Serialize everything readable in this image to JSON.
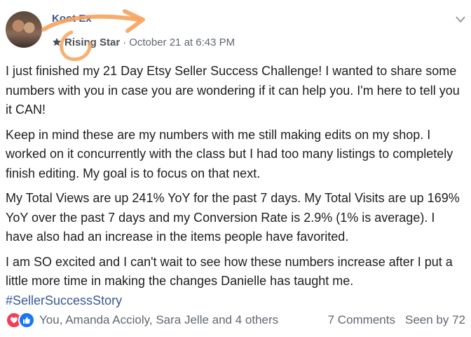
{
  "post": {
    "author": "Koot Ex",
    "badge": "Rising Star",
    "separator": "·",
    "timestamp": "October 21 at 6:43 PM",
    "paragraphs": [
      "I just finished my 21 Day Etsy Seller Success Challenge! I wanted to share some numbers with you in case you are wondering if it can help you. I'm here to tell you it CAN!",
      "Keep in mind these are my numbers with me still making edits on my shop. I worked on it concurrently with the class but I had too many listings to completely finish editing. My goal is to focus on that next.",
      "My Total Views are up 241% YoY for the past 7 days. My Total Visits are up 169% YoY over the past 7 days and my Conversion Rate is 2.9% (1% is average). I have also had an increase in the items people have favorited.",
      "I am SO excited and I can't wait to see how these numbers increase after I put a little more time in making the changes Danielle has taught me."
    ],
    "hashtag": "#SellerSuccessStory"
  },
  "footer": {
    "reactors": "You, Amanda Accioly, Sara Jelle and 4 others",
    "comments": "7 Comments",
    "seen_by": "Seen by 72"
  },
  "icons": {
    "badge": "star-icon",
    "menu": "chevron-down-icon",
    "love": "heart-icon",
    "like": "thumbs-up-icon"
  },
  "colors": {
    "link": "#385898",
    "love": "#f33e58",
    "like": "#1877f2",
    "annotation_arrow": "#f5a35c"
  }
}
